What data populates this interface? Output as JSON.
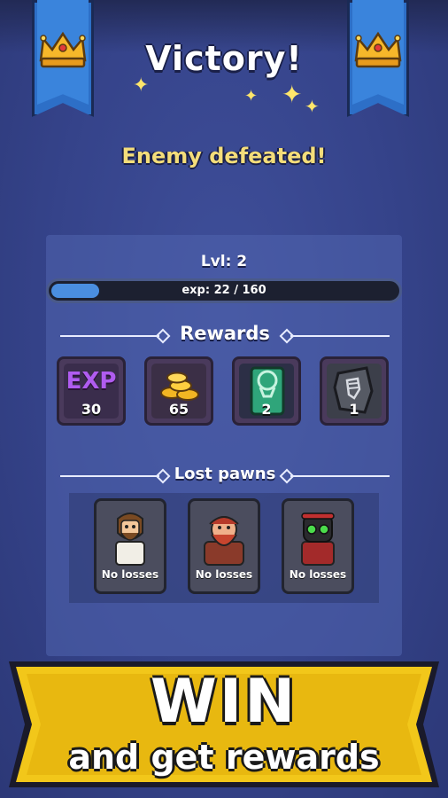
{
  "header": {
    "title": "Victory!",
    "subtitle": "Enemy defeated!"
  },
  "progress": {
    "level_label": "Lvl: 2",
    "exp_label": "exp: 22 / 160",
    "exp_current": 22,
    "exp_max": 160
  },
  "rewards": {
    "heading": "Rewards",
    "items": [
      {
        "icon": "exp-icon",
        "icon_text": "EXP",
        "count": "30"
      },
      {
        "icon": "gold-coins-icon",
        "count": "65"
      },
      {
        "icon": "scroll-ticket-icon",
        "count": "2"
      },
      {
        "icon": "fist-rune-icon",
        "count": "1"
      }
    ]
  },
  "lost_pawns": {
    "heading": "Lost pawns",
    "items": [
      {
        "icon": "bearded-monk-portrait",
        "caption": "No losses"
      },
      {
        "icon": "red-bearded-dwarf-portrait",
        "caption": "No losses"
      },
      {
        "icon": "green-eyed-robot-portrait",
        "caption": "No losses"
      }
    ]
  },
  "promo": {
    "headline": "WIN",
    "subline": "and get rewards"
  },
  "colors": {
    "background": "#35438a",
    "banner_blue": "#2d6fc7",
    "gold_text": "#f4dd7a",
    "exp_fill": "#4a8ee0",
    "promo_yellow": "#f2c71a"
  }
}
